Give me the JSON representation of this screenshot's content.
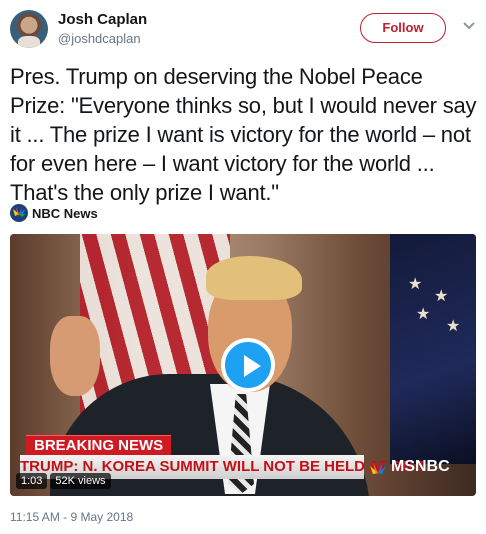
{
  "tweet": {
    "author_name": "Josh Caplan",
    "author_handle": "@joshdcaplan",
    "follow_label": "Follow",
    "text": "Pres. Trump on deserving the Nobel Peace Prize: \"Everyone thinks so, but I would never say it ... The prize I want is victory for the world – not for even here – I want victory for the world ... That's the only prize I want.\"",
    "source_label": "NBC News",
    "timestamp": "11:15 AM - 9 May 2018"
  },
  "video": {
    "breaking_label": "BREAKING NEWS",
    "ticker_text": "TRUMP: N. KOREA SUMMIT WILL NOT BE HELD AT DMZ",
    "network_label": "MSNBC",
    "duration": "1:03",
    "views": "52K views"
  },
  "icons": {
    "more": "chevron-down-icon",
    "play": "play-icon",
    "source_logo": "nbc-peacock-icon"
  },
  "colors": {
    "follow_accent": "#c0202e",
    "play_button": "#1da1f2",
    "breaking_red": "#d01a23",
    "muted_text": "#657786"
  }
}
